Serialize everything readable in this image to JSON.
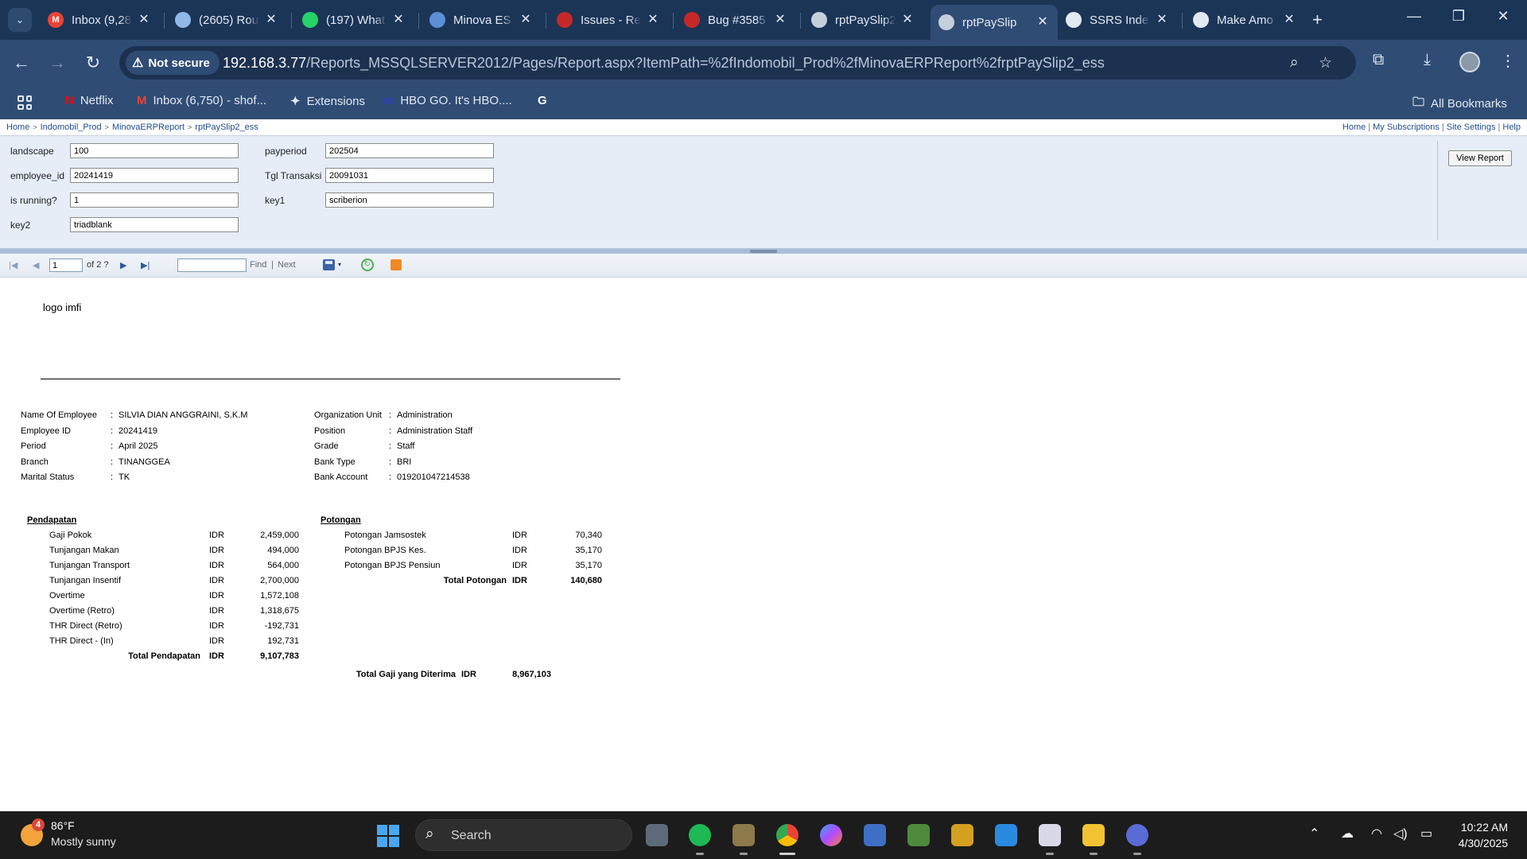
{
  "browser": {
    "tabs": [
      {
        "title": "Inbox (9,28",
        "icon": "gmail-icon",
        "color": "#ea4335",
        "glyph": "M"
      },
      {
        "title": "(2605) Rou",
        "icon": "chat-cloud-icon",
        "color": "#8fb8e8",
        "glyph": ""
      },
      {
        "title": "(197) What",
        "icon": "whatsapp-icon",
        "color": "#25d366",
        "glyph": ""
      },
      {
        "title": "Minova ES",
        "icon": "cube-icon",
        "color": "#5b8fd6",
        "glyph": ""
      },
      {
        "title": "Issues - Re",
        "icon": "redmine-icon",
        "color": "#c62828",
        "glyph": ""
      },
      {
        "title": "Bug #3585",
        "icon": "redmine-icon",
        "color": "#c62828",
        "glyph": ""
      },
      {
        "title": "rptPaySlip2",
        "icon": "globe-icon",
        "color": "#c5cfdb",
        "glyph": ""
      },
      {
        "title": "rptPaySlip",
        "icon": "globe-icon",
        "color": "#c5cfdb",
        "glyph": ""
      },
      {
        "title": "SSRS Inde",
        "icon": "openai-icon",
        "color": "#e3e9f2",
        "glyph": ""
      },
      {
        "title": "Make Amo",
        "icon": "openai-icon",
        "color": "#e3e9f2",
        "glyph": ""
      }
    ],
    "active_tab": 7,
    "security_label": "Not secure",
    "url_host": "192.168.3.77",
    "url_path": "/Reports_MSSQLSERVER2012/Pages/Report.aspx?ItemPath=%2fIndomobil_Prod%2fMinovaERPReport%2frptPaySlip2_ess",
    "bookmarks": [
      {
        "label": "Netflix",
        "icon": "netflix-icon",
        "color": "#e50914",
        "glyph": "N"
      },
      {
        "label": "Inbox (6,750) - shof...",
        "icon": "gmail-icon",
        "color": "#ea4335",
        "glyph": "M"
      },
      {
        "label": "Extensions",
        "icon": "puzzle-icon",
        "color": "#e3e9f2",
        "glyph": "✦"
      },
      {
        "label": "HBO GO. It's HBO....",
        "icon": "hbo-icon",
        "color": "#2c3fbf",
        "glyph": "m"
      },
      {
        "label": "",
        "icon": "google-icon",
        "color": "#ffffff",
        "glyph": "G"
      }
    ],
    "all_bookmarks": "All Bookmarks"
  },
  "ssrs": {
    "breadcrumbs": [
      "Home",
      "Indomobil_Prod",
      "MinovaERPReport",
      "rptPaySlip2_ess"
    ],
    "toplinks": [
      "Home",
      "My Subscriptions",
      "Site Settings",
      "Help"
    ],
    "params": {
      "landscape": {
        "label": "landscape",
        "value": "100"
      },
      "employee_id": {
        "label": "employee_id",
        "value": "20241419"
      },
      "is_running": {
        "label": "is running?",
        "value": "1"
      },
      "key2": {
        "label": "key2",
        "value": "triadblank"
      },
      "payperiod": {
        "label": "payperiod",
        "value": "202504"
      },
      "tgl_transaksi": {
        "label": "Tgl Transaksi",
        "value": "20091031"
      },
      "key1": {
        "label": "key1",
        "value": "scriberion"
      }
    },
    "view_report": "View Report",
    "toolbar": {
      "page": "1",
      "of_pages": "of 2 ?",
      "find": "Find",
      "next": "Next",
      "sep": "|"
    }
  },
  "report": {
    "logo": "logo imfi",
    "info_left": [
      {
        "label": "Name Of Employee",
        "value": "SILVIA DIAN ANGGRAINI, S.K.M"
      },
      {
        "label": "Employee ID",
        "value": "20241419"
      },
      {
        "label": "Period",
        "value": "April 2025"
      },
      {
        "label": "Branch",
        "value": "TINANGGEA"
      },
      {
        "label": "Marital Status",
        "value": "TK"
      }
    ],
    "info_right": [
      {
        "label": "Organization Unit",
        "value": "Administration"
      },
      {
        "label": "Position",
        "value": "Administration Staff"
      },
      {
        "label": "Grade",
        "value": "Staff"
      },
      {
        "label": "Bank Type",
        "value": "BRI"
      },
      {
        "label": "Bank Account",
        "value": "019201047214538"
      }
    ],
    "colon": ":",
    "pendapatan_title": "Pendapatan",
    "pendapatan": [
      {
        "name": "Gaji Pokok",
        "cur": "IDR",
        "amount": "2,459,000"
      },
      {
        "name": "Tunjangan Makan",
        "cur": "IDR",
        "amount": "494,000"
      },
      {
        "name": "Tunjangan Transport",
        "cur": "IDR",
        "amount": "564,000"
      },
      {
        "name": "Tunjangan Insentif",
        "cur": "IDR",
        "amount": "2,700,000"
      },
      {
        "name": "Overtime",
        "cur": "IDR",
        "amount": "1,572,108"
      },
      {
        "name": "Overtime (Retro)",
        "cur": "IDR",
        "amount": "1,318,675"
      },
      {
        "name": "THR Direct (Retro)",
        "cur": "IDR",
        "amount": "-192,731"
      },
      {
        "name": "THR Direct - (In)",
        "cur": "IDR",
        "amount": "192,731"
      }
    ],
    "total_pendapatan": {
      "label": "Total Pendapatan",
      "cur": "IDR",
      "amount": "9,107,783"
    },
    "potongan_title": "Potongan",
    "potongan": [
      {
        "name": "Potongan Jamsostek",
        "cur": "IDR",
        "amount": "70,340"
      },
      {
        "name": "Potongan BPJS Kes.",
        "cur": "IDR",
        "amount": "35,170"
      },
      {
        "name": "Potongan BPJS Pensiun",
        "cur": "IDR",
        "amount": "35,170"
      }
    ],
    "total_potongan": {
      "label": "Total Potongan",
      "cur": "IDR",
      "amount": "140,680"
    },
    "total_gaji": {
      "label": "Total Gaji yang Diterima",
      "cur": "IDR",
      "amount": "8,967,103"
    }
  },
  "taskbar": {
    "weather_badge": "4",
    "temp": "86°F",
    "condition": "Mostly sunny",
    "search": "Search",
    "time": "10:22 AM",
    "date": "4/30/2025"
  }
}
